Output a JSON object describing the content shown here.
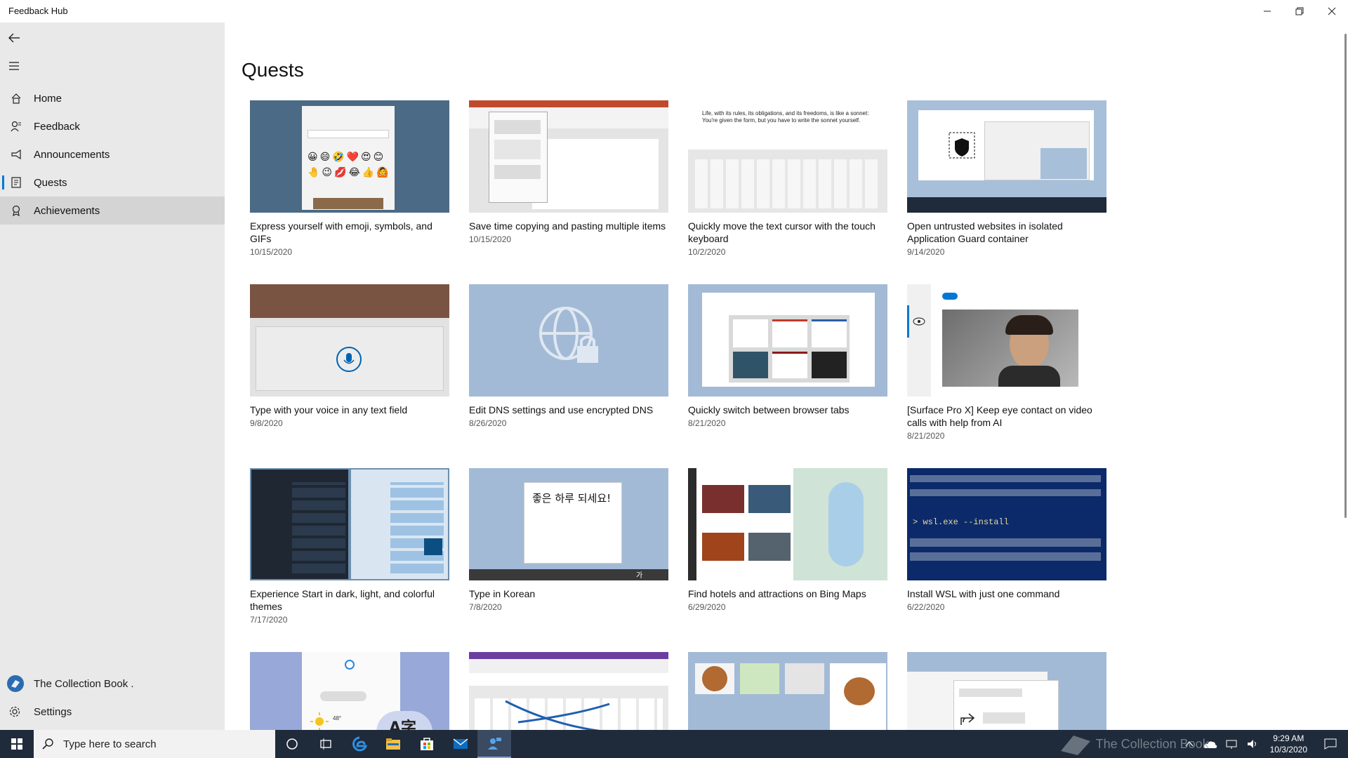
{
  "window": {
    "title": "Feedback Hub"
  },
  "sidebar": {
    "items": [
      {
        "label": "Home",
        "icon": "home-icon"
      },
      {
        "label": "Feedback",
        "icon": "feedback-icon"
      },
      {
        "label": "Announcements",
        "icon": "megaphone-icon"
      },
      {
        "label": "Quests",
        "icon": "quests-icon"
      },
      {
        "label": "Achievements",
        "icon": "achievements-icon"
      }
    ],
    "selected": "Quests",
    "user": "The Collection Book .",
    "settings": "Settings"
  },
  "main": {
    "title": "Quests",
    "quests": [
      {
        "title": "Express yourself with emoji, symbols, and GIFs",
        "date": "10/15/2020"
      },
      {
        "title": "Save time copying and pasting multiple items",
        "date": "10/15/2020"
      },
      {
        "title": "Quickly move the text cursor with the touch keyboard",
        "date": "10/2/2020"
      },
      {
        "title": "Open untrusted websites in isolated Application Guard container",
        "date": "9/14/2020"
      },
      {
        "title": "Type with your voice in any text field",
        "date": "9/8/2020"
      },
      {
        "title": "Edit DNS settings and use encrypted DNS",
        "date": "8/26/2020"
      },
      {
        "title": "Quickly switch between browser tabs",
        "date": "8/21/2020"
      },
      {
        "title": "[Surface Pro X] Keep eye contact on video calls with help from AI",
        "date": "8/21/2020"
      },
      {
        "title": "Experience Start in dark, light, and colorful themes",
        "date": "7/17/2020"
      },
      {
        "title": "Type in Korean",
        "date": "7/8/2020"
      },
      {
        "title": "Find hotels and attractions on Bing Maps",
        "date": "6/29/2020"
      },
      {
        "title": "Install WSL with just one command",
        "date": "6/22/2020"
      }
    ],
    "thumb_text": {
      "typing_text": "Life, with its rules, its obligations, and its freedoms, is like a sonnet: You're given the form, but you have to write the sonnet yourself.",
      "korean_text": "좋은 하루 되세요!",
      "korean_ime_label": "가",
      "wsl_command": "> wsl.exe --install",
      "translate_glyph": "A字",
      "weather_temp": "48°"
    }
  },
  "taskbar": {
    "search_placeholder": "Type here to search",
    "time": "9:29 AM",
    "date": "10/3/2020",
    "watermark": "The Collection Book"
  },
  "colors": {
    "accent": "#0078d4",
    "sidebar_bg": "#e9e9e9",
    "taskbar_bg": "#1f2a3a"
  }
}
